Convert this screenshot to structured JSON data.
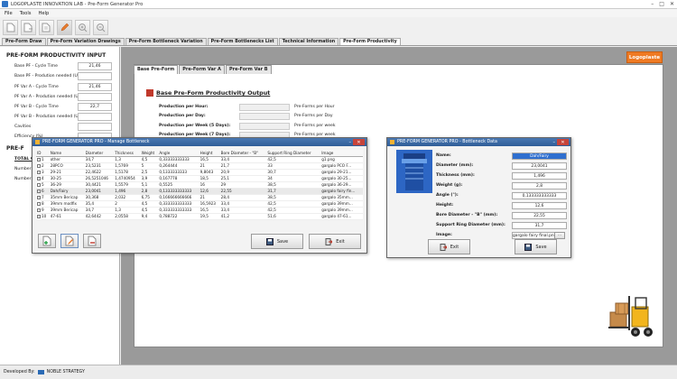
{
  "window": {
    "title": "LOGOPLASTE INNOVATION LAB - Pre-Form Generator Pro"
  },
  "menu": [
    "File",
    "Tools",
    "Help"
  ],
  "tabs": [
    {
      "label": "Pre-Form Draw"
    },
    {
      "label": "Pre-Form Variation Drawings"
    },
    {
      "label": "Pre-Form Bottleneck Variation"
    },
    {
      "label": "Pre-Form Bottlenecks List"
    },
    {
      "label": "Technical Information"
    },
    {
      "label": "Pre-Form Productivity"
    }
  ],
  "left_panel": {
    "title": "PRE-FORM PRODUCTIVITY INPUT",
    "rows": [
      {
        "label": "Base PF - Cycle Time",
        "value": "21,46"
      },
      {
        "label": "Base PF - Prodution needed (Units)",
        "value": ""
      },
      {
        "label": "PF Var A - Cycle Time",
        "value": "21,46"
      },
      {
        "label": "PF Var A - Prodution needed (Units)",
        "value": ""
      },
      {
        "label": "PF Var B - Cycle Time",
        "value": "22,7"
      },
      {
        "label": "PF Var B - Prodution needed (Units)",
        "value": ""
      },
      {
        "label": "Cavities",
        "value": ""
      },
      {
        "label": "Efficiency (%)",
        "value": ""
      }
    ],
    "section2_title": "PRE-F",
    "section2_rows": [
      "TOTAL C",
      "Number o",
      "Number o"
    ]
  },
  "inner_tabs": [
    {
      "label": "Base Pre-Form"
    },
    {
      "label": "Pre-Form Var A"
    },
    {
      "label": "Pre-Form Var B"
    }
  ],
  "logo": "Logoplaste",
  "base_output": {
    "title": "Base Pre-Form Productivity Output",
    "rows": [
      {
        "label": "Production per Hour:",
        "unit": "Pre-Forms per Hour"
      },
      {
        "label": "Production per Day:",
        "unit": "Pre-Forms per Day"
      },
      {
        "label": "Production per Week (5 Days):",
        "unit": "Pre-Forms per week"
      },
      {
        "label": "Production per Week (7 Days):",
        "unit": "Pre-Forms per week"
      }
    ]
  },
  "manage_dialog": {
    "title": "PRE-FORM GENERATOR PRO - Manage Bottleneck",
    "columns": [
      "ID",
      "Name",
      "Diameter",
      "Thickness",
      "Weight",
      "Angle",
      "Height",
      "Bore Diameter - \"B\"",
      "Support Ring Diameter",
      "Image"
    ],
    "rows": [
      [
        "1",
        "other",
        "34,7",
        "1,3",
        "4,5",
        "0,33333333333",
        "16,5",
        "33,4",
        "42,5",
        "g1.png"
      ],
      [
        "2",
        "28PCO",
        "23,5231",
        "1,5769",
        "5",
        "0,264444",
        "21",
        "21,7",
        "33",
        "gargalo PCO F..."
      ],
      [
        "3",
        "29-21",
        "22,4622",
        "1,5178",
        "2,5",
        "0,1333333333",
        "9,8043",
        "20,9",
        "30,7",
        "gargalo 29-21..."
      ],
      [
        "4",
        "30-25",
        "26,5251046",
        "1,4740954",
        "3,9",
        "0,167778",
        "18,5",
        "25,1",
        "34",
        "gargalo 30-25..."
      ],
      [
        "5",
        "36-29",
        "30,4421",
        "1,5579",
        "5,1",
        "0,5525",
        "16",
        "29",
        "38,5",
        "gargalo 36-29..."
      ],
      [
        "6",
        "Dah/Fairy",
        "23,0041",
        "1,496",
        "2,8",
        "0,133333333333",
        "12,6",
        "22,55",
        "31,7",
        "gargalo fairy fin..."
      ],
      [
        "7",
        "35mm Bericap",
        "30,368",
        "2,032",
        "6,75",
        "0,166666666666",
        "21",
        "28,4",
        "38,5",
        "gargalo 35mm..."
      ],
      [
        "8",
        "39mm modfix",
        "35,4",
        "2",
        "4,5",
        "0,333333333333",
        "16,5923",
        "33,4",
        "42,5",
        "gargalo 39mm..."
      ],
      [
        "9",
        "39mm Bericap",
        "34,7",
        "1,3",
        "4,5",
        "0,333333333333",
        "16,5",
        "33,4",
        "42,5",
        "gargalo 39mm..."
      ],
      [
        "10",
        "47-61",
        "42,6442",
        "2,0558",
        "9,4",
        "0,788722",
        "19,5",
        "41,2",
        "51,6",
        "gargalo 47-61..."
      ]
    ],
    "selected_row": 5,
    "save_label": "Save",
    "exit_label": "Exit"
  },
  "bottleneck_dialog": {
    "title": "PRE-FORM GENERATOR PRO - Bottleneck Data",
    "fields": [
      {
        "label": "Name:",
        "value": "Dah/Fairy"
      },
      {
        "label": "Diameter (mm):",
        "value": "23,0041"
      },
      {
        "label": "Thickness (mm):",
        "value": "1,496"
      },
      {
        "label": "Weight (g):",
        "value": "2,8"
      },
      {
        "label": "Angle (°):",
        "value": "0,133333333333"
      },
      {
        "label": "Height:",
        "value": "12,6"
      },
      {
        "label": "Bore Diameter - \"B\" (mm):",
        "value": "22,55"
      },
      {
        "label": "Support Ring Diameter (mm):",
        "value": "31,7"
      },
      {
        "label": "Image:",
        "value": "gargalo fairy final.png"
      }
    ],
    "browse_label": "...",
    "exit_label": "Exit",
    "save_label": "Save"
  },
  "status": {
    "label": "Developed By:",
    "company": "NOBLE STRATEGY"
  },
  "colors": {
    "accent": "#2f5d97",
    "logo": "#ef7a23",
    "bullet": "#c0392b"
  }
}
